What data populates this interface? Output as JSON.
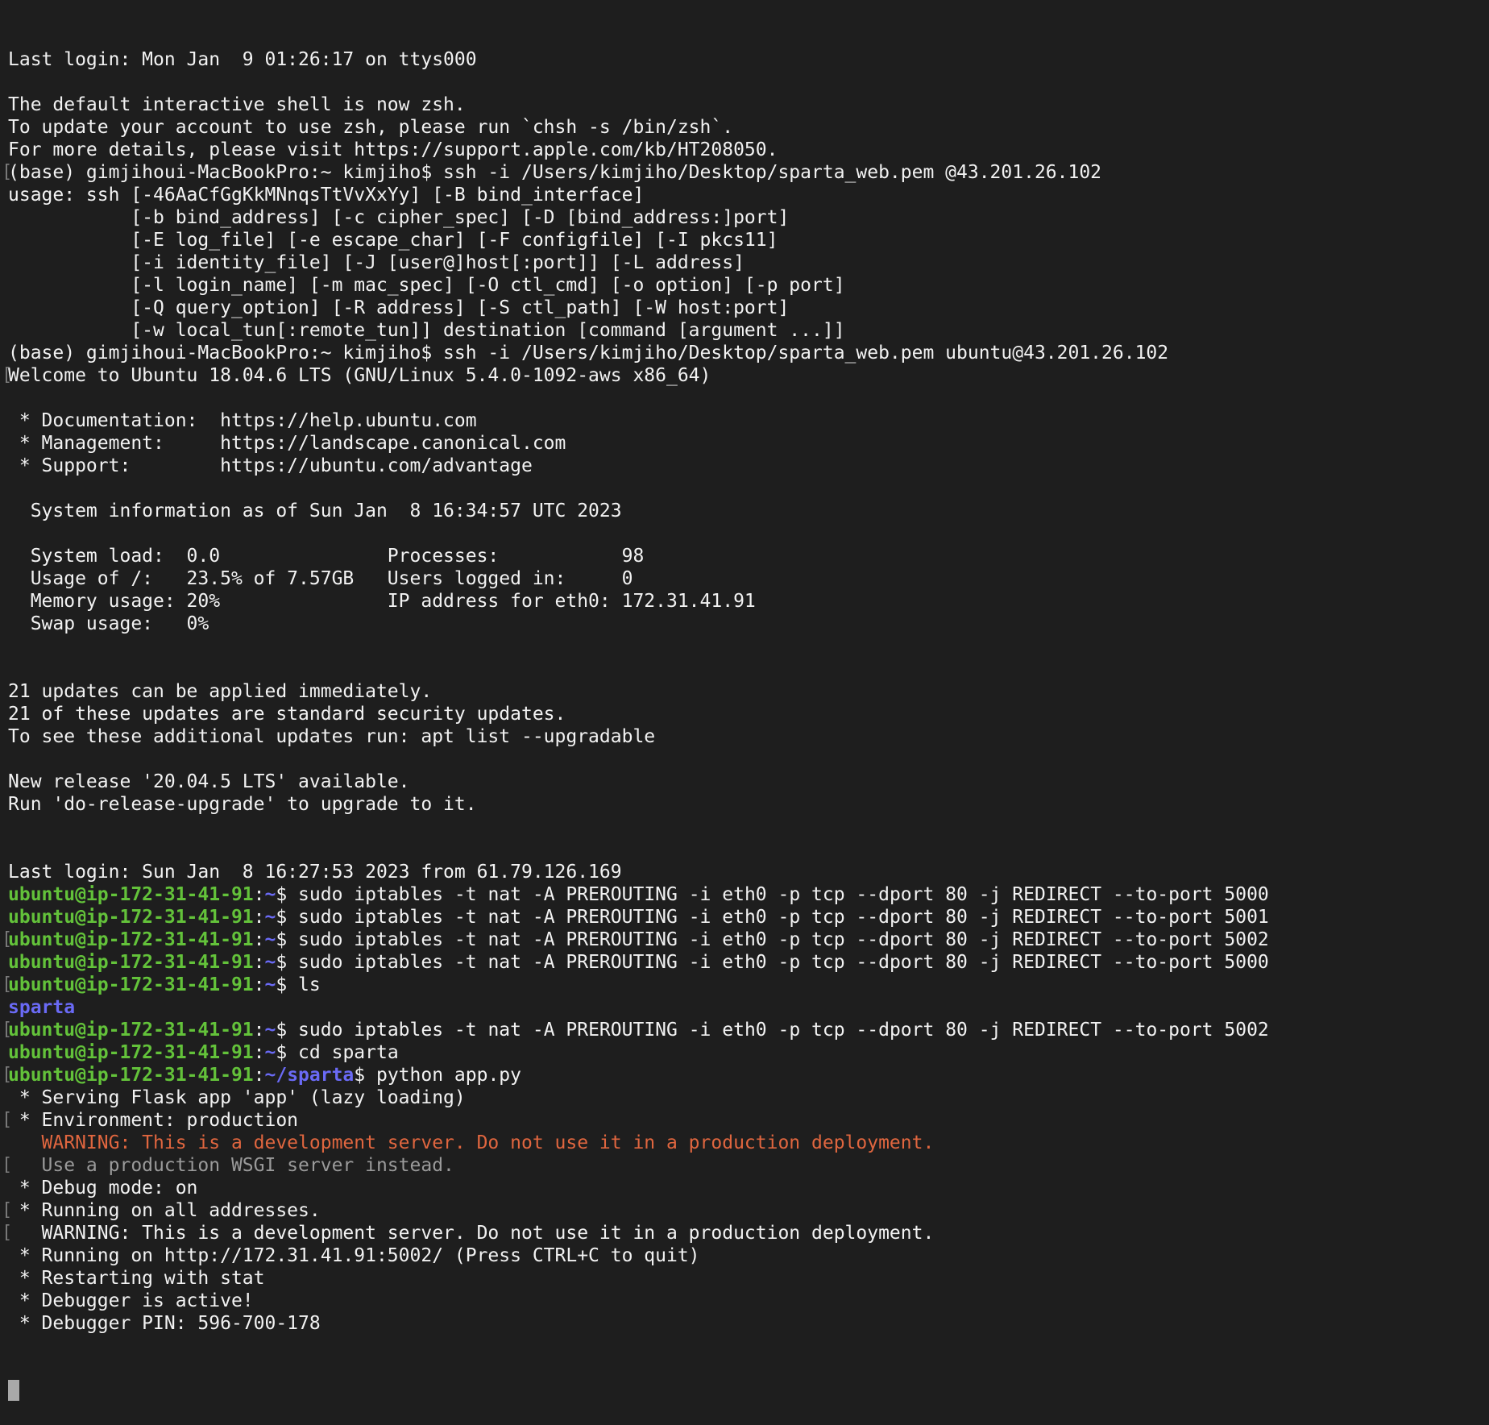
{
  "terminal": {
    "colors": {
      "background": "#1e1e1e",
      "text": "#f2f2f2",
      "prompt_user": "#63c23a",
      "prompt_path": "#6a6af5",
      "directory": "#6a6af5",
      "warning": "#e0663f",
      "dim": "#9a9a9a",
      "cursor": "#a9a9a9"
    },
    "lines": [
      {
        "m": false,
        "s": [
          {
            "t": "Last login: Mon Jan  9 01:26:17 on ttys000"
          }
        ]
      },
      {
        "m": false,
        "s": [
          {
            "t": ""
          }
        ]
      },
      {
        "m": false,
        "s": [
          {
            "t": "The default interactive shell is now zsh."
          }
        ]
      },
      {
        "m": false,
        "s": [
          {
            "t": "To update your account to use zsh, please run `chsh -s /bin/zsh`."
          }
        ]
      },
      {
        "m": false,
        "s": [
          {
            "t": "For more details, please visit https://support.apple.com/kb/HT208050."
          }
        ]
      },
      {
        "m": true,
        "s": [
          {
            "t": "(base) gimjihoui-MacBookPro:~ kimjiho$ ssh -i /Users/kimjiho/Desktop/sparta_web.pem @43.201.26.102"
          }
        ]
      },
      {
        "m": false,
        "s": [
          {
            "t": "usage: ssh [-46AaCfGgKkMNnqsTtVvXxYy] [-B bind_interface]"
          }
        ]
      },
      {
        "m": false,
        "s": [
          {
            "t": "           [-b bind_address] [-c cipher_spec] [-D [bind_address:]port]"
          }
        ]
      },
      {
        "m": false,
        "s": [
          {
            "t": "           [-E log_file] [-e escape_char] [-F configfile] [-I pkcs11]"
          }
        ]
      },
      {
        "m": false,
        "s": [
          {
            "t": "           [-i identity_file] [-J [user@]host[:port]] [-L address]"
          }
        ]
      },
      {
        "m": false,
        "s": [
          {
            "t": "           [-l login_name] [-m mac_spec] [-O ctl_cmd] [-o option] [-p port]"
          }
        ]
      },
      {
        "m": false,
        "s": [
          {
            "t": "           [-Q query_option] [-R address] [-S ctl_path] [-W host:port]"
          }
        ]
      },
      {
        "m": false,
        "s": [
          {
            "t": "           [-w local_tun[:remote_tun]] destination [command [argument ...]]"
          }
        ]
      },
      {
        "m": false,
        "s": [
          {
            "t": "(base) gimjihoui-MacBookPro:~ kimjiho$ ssh -i /Users/kimjiho/Desktop/sparta_web.pem ubuntu@43.201.26.102"
          }
        ]
      },
      {
        "m": true,
        "s": [
          {
            "t": "Welcome to Ubuntu 18.04.6 LTS (GNU/Linux 5.4.0-1092-aws x86_64)"
          }
        ]
      },
      {
        "m": false,
        "s": [
          {
            "t": ""
          }
        ]
      },
      {
        "m": false,
        "s": [
          {
            "t": " * Documentation:  https://help.ubuntu.com"
          }
        ]
      },
      {
        "m": false,
        "s": [
          {
            "t": " * Management:     https://landscape.canonical.com"
          }
        ]
      },
      {
        "m": false,
        "s": [
          {
            "t": " * Support:        https://ubuntu.com/advantage"
          }
        ]
      },
      {
        "m": false,
        "s": [
          {
            "t": ""
          }
        ]
      },
      {
        "m": false,
        "s": [
          {
            "t": "  System information as of Sun Jan  8 16:34:57 UTC 2023"
          }
        ]
      },
      {
        "m": false,
        "s": [
          {
            "t": ""
          }
        ]
      },
      {
        "m": false,
        "s": [
          {
            "t": "  System load:  0.0               Processes:           98"
          }
        ]
      },
      {
        "m": false,
        "s": [
          {
            "t": "  Usage of /:   23.5% of 7.57GB   Users logged in:     0"
          }
        ]
      },
      {
        "m": false,
        "s": [
          {
            "t": "  Memory usage: 20%               IP address for eth0: 172.31.41.91"
          }
        ]
      },
      {
        "m": false,
        "s": [
          {
            "t": "  Swap usage:   0%"
          }
        ]
      },
      {
        "m": false,
        "s": [
          {
            "t": ""
          }
        ]
      },
      {
        "m": false,
        "s": [
          {
            "t": ""
          }
        ]
      },
      {
        "m": false,
        "s": [
          {
            "t": "21 updates can be applied immediately."
          }
        ]
      },
      {
        "m": false,
        "s": [
          {
            "t": "21 of these updates are standard security updates."
          }
        ]
      },
      {
        "m": false,
        "s": [
          {
            "t": "To see these additional updates run: apt list --upgradable"
          }
        ]
      },
      {
        "m": false,
        "s": [
          {
            "t": ""
          }
        ]
      },
      {
        "m": false,
        "s": [
          {
            "t": "New release '20.04.5 LTS' available."
          }
        ]
      },
      {
        "m": false,
        "s": [
          {
            "t": "Run 'do-release-upgrade' to upgrade to it."
          }
        ]
      },
      {
        "m": false,
        "s": [
          {
            "t": ""
          }
        ]
      },
      {
        "m": false,
        "s": [
          {
            "t": ""
          }
        ]
      },
      {
        "m": false,
        "s": [
          {
            "t": "Last login: Sun Jan  8 16:27:53 2023 from 61.79.126.169"
          }
        ]
      },
      {
        "m": false,
        "s": [
          {
            "t": "ubuntu@ip-172-31-41-91",
            "c": "user"
          },
          {
            "t": ":"
          },
          {
            "t": "~",
            "c": "path"
          },
          {
            "t": "$ sudo iptables -t nat -A PREROUTING -i eth0 -p tcp --dport 80 -j REDIRECT --to-port 5000"
          }
        ]
      },
      {
        "m": false,
        "s": [
          {
            "t": "ubuntu@ip-172-31-41-91",
            "c": "user"
          },
          {
            "t": ":"
          },
          {
            "t": "~",
            "c": "path"
          },
          {
            "t": "$ sudo iptables -t nat -A PREROUTING -i eth0 -p tcp --dport 80 -j REDIRECT --to-port 5001"
          }
        ]
      },
      {
        "m": true,
        "s": [
          {
            "t": "ubuntu@ip-172-31-41-91",
            "c": "user"
          },
          {
            "t": ":"
          },
          {
            "t": "~",
            "c": "path"
          },
          {
            "t": "$ sudo iptables -t nat -A PREROUTING -i eth0 -p tcp --dport 80 -j REDIRECT --to-port 5002"
          }
        ]
      },
      {
        "m": false,
        "s": [
          {
            "t": "ubuntu@ip-172-31-41-91",
            "c": "user"
          },
          {
            "t": ":"
          },
          {
            "t": "~",
            "c": "path"
          },
          {
            "t": "$ sudo iptables -t nat -A PREROUTING -i eth0 -p tcp --dport 80 -j REDIRECT --to-port 5000"
          }
        ]
      },
      {
        "m": true,
        "s": [
          {
            "t": "ubuntu@ip-172-31-41-91",
            "c": "user"
          },
          {
            "t": ":"
          },
          {
            "t": "~",
            "c": "path"
          },
          {
            "t": "$ ls"
          }
        ]
      },
      {
        "m": false,
        "s": [
          {
            "t": "sparta",
            "c": "dir"
          }
        ]
      },
      {
        "m": true,
        "s": [
          {
            "t": "ubuntu@ip-172-31-41-91",
            "c": "user"
          },
          {
            "t": ":"
          },
          {
            "t": "~",
            "c": "path"
          },
          {
            "t": "$ sudo iptables -t nat -A PREROUTING -i eth0 -p tcp --dport 80 -j REDIRECT --to-port 5002"
          }
        ]
      },
      {
        "m": false,
        "s": [
          {
            "t": "ubuntu@ip-172-31-41-91",
            "c": "user"
          },
          {
            "t": ":"
          },
          {
            "t": "~",
            "c": "path"
          },
          {
            "t": "$ cd sparta"
          }
        ]
      },
      {
        "m": true,
        "s": [
          {
            "t": "ubuntu@ip-172-31-41-91",
            "c": "user"
          },
          {
            "t": ":"
          },
          {
            "t": "~/sparta",
            "c": "path"
          },
          {
            "t": "$ python app.py"
          }
        ]
      },
      {
        "m": false,
        "s": [
          {
            "t": " * Serving Flask app 'app' (lazy loading)"
          }
        ]
      },
      {
        "m": true,
        "s": [
          {
            "t": " * Environment: production"
          }
        ]
      },
      {
        "m": false,
        "s": [
          {
            "t": "   WARNING: This is a development server. Do not use it in a production deployment.",
            "c": "warn"
          }
        ]
      },
      {
        "m": true,
        "s": [
          {
            "t": "   Use a production WSGI server instead.",
            "c": "dim"
          }
        ]
      },
      {
        "m": false,
        "s": [
          {
            "t": " * Debug mode: on"
          }
        ]
      },
      {
        "m": true,
        "s": [
          {
            "t": " * Running on all addresses."
          }
        ]
      },
      {
        "m": true,
        "s": [
          {
            "t": "   WARNING: This is a development server. Do not use it in a production deployment."
          }
        ]
      },
      {
        "m": false,
        "s": [
          {
            "t": " * Running on http://172.31.41.91:5002/ (Press CTRL+C to quit)"
          }
        ]
      },
      {
        "m": false,
        "s": [
          {
            "t": " * Restarting with stat"
          }
        ]
      },
      {
        "m": false,
        "s": [
          {
            "t": " * Debugger is active!"
          }
        ]
      },
      {
        "m": false,
        "s": [
          {
            "t": " * Debugger PIN: 596-700-178"
          }
        ]
      }
    ]
  }
}
